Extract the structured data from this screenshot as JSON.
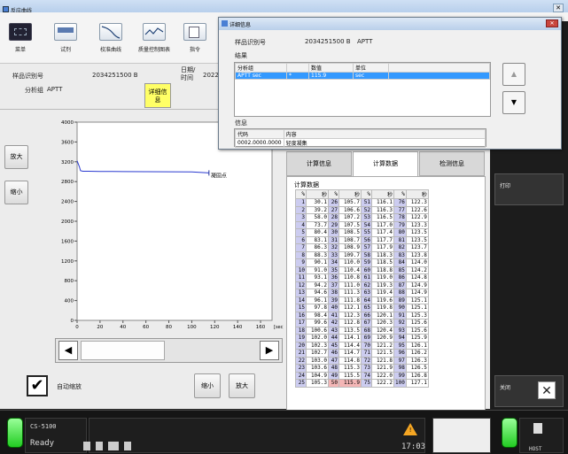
{
  "window": {
    "title": "反应曲线",
    "close": "✕"
  },
  "toolbar": [
    {
      "label": "菜单",
      "icon": "keypad-icon"
    },
    {
      "label": "试剂",
      "icon": "reagent-icon"
    },
    {
      "label": "校准曲线",
      "icon": "calibration-curve-icon"
    },
    {
      "label": "质量控制图表",
      "icon": "qc-chart-icon"
    },
    {
      "label": "指令",
      "icon": "command-icon"
    }
  ],
  "sample": {
    "id_label": "样品识别号",
    "id_value": "2034251500 B",
    "group_label": "分析组",
    "group_value": "APTT",
    "date_label": "日期/\n时间",
    "date_value": "2022-",
    "detail_button": "详细信\n息"
  },
  "left_buttons": {
    "zoom_in": "放大",
    "zoom_out": "缩小"
  },
  "chart_data": {
    "type": "line",
    "x": [
      0,
      2,
      3,
      5,
      10,
      20,
      40,
      60,
      80,
      100,
      115
    ],
    "y": [
      3220,
      3100,
      3020,
      3010,
      3008,
      3005,
      3003,
      3000,
      2998,
      2995,
      2975
    ],
    "xticks": [
      "0",
      "20",
      "40",
      "60",
      "80",
      "100",
      "120",
      "140",
      "160"
    ],
    "yticks": [
      "0",
      "200",
      "400",
      "600",
      "800",
      "1000",
      "1200",
      "1400",
      "1600",
      "1800",
      "2000",
      "2200",
      "2400",
      "2600",
      "2800",
      "3000",
      "3200",
      "3400",
      "3600",
      "3800",
      "4000"
    ],
    "yticks_shown": [
      "0",
      "400",
      "800",
      "1200",
      "1600",
      "2000",
      "2400",
      "2800",
      "3200",
      "3600",
      "4000"
    ],
    "xlim": [
      0,
      170
    ],
    "ylim": [
      0,
      4000
    ],
    "xunit": "[sec]",
    "annotation": "凝固点",
    "annotation_x": 115,
    "annotation_y": 2975,
    "line_color": "#2a3ad0"
  },
  "auto_zoom": {
    "label": "自动缩放",
    "checked": "✔"
  },
  "bottom_buttons": {
    "zoom_out": "缩小",
    "zoom_in": "放大"
  },
  "tabs": [
    "计算信息",
    "计算数据",
    "检测信息"
  ],
  "calc_data": {
    "caption": "计算数据",
    "header": [
      "%",
      "秒",
      "%",
      "秒",
      "%",
      "秒",
      "%",
      "秒"
    ],
    "rows": [
      [
        "1",
        "30.1",
        "26",
        "105.7",
        "51",
        "116.1",
        "76",
        "122.3"
      ],
      [
        "2",
        "39.2",
        "27",
        "106.6",
        "52",
        "116.3",
        "77",
        "122.6"
      ],
      [
        "3",
        "58.0",
        "28",
        "107.2",
        "53",
        "116.5",
        "78",
        "122.9"
      ],
      [
        "4",
        "73.7",
        "29",
        "107.5",
        "54",
        "117.0",
        "79",
        "123.3"
      ],
      [
        "5",
        "80.4",
        "30",
        "108.5",
        "55",
        "117.4",
        "80",
        "123.5"
      ],
      [
        "6",
        "83.1",
        "31",
        "108.7",
        "56",
        "117.7",
        "81",
        "123.5"
      ],
      [
        "7",
        "86.3",
        "32",
        "108.9",
        "57",
        "117.9",
        "82",
        "123.7"
      ],
      [
        "8",
        "88.3",
        "33",
        "109.7",
        "58",
        "118.3",
        "83",
        "123.8"
      ],
      [
        "9",
        "90.1",
        "34",
        "110.0",
        "59",
        "118.5",
        "84",
        "124.0"
      ],
      [
        "10",
        "91.0",
        "35",
        "110.4",
        "60",
        "118.8",
        "85",
        "124.2"
      ],
      [
        "11",
        "93.1",
        "36",
        "110.8",
        "61",
        "119.0",
        "86",
        "124.8"
      ],
      [
        "12",
        "94.2",
        "37",
        "111.0",
        "62",
        "119.3",
        "87",
        "124.9"
      ],
      [
        "13",
        "94.6",
        "38",
        "111.3",
        "63",
        "119.4",
        "88",
        "124.9"
      ],
      [
        "14",
        "96.1",
        "39",
        "111.8",
        "64",
        "119.6",
        "89",
        "125.1"
      ],
      [
        "15",
        "97.8",
        "40",
        "112.1",
        "65",
        "119.8",
        "90",
        "125.1"
      ],
      [
        "16",
        "98.4",
        "41",
        "112.3",
        "66",
        "120.1",
        "91",
        "125.3"
      ],
      [
        "17",
        "99.6",
        "42",
        "112.8",
        "67",
        "120.3",
        "92",
        "125.6"
      ],
      [
        "18",
        "100.6",
        "43",
        "113.5",
        "68",
        "120.4",
        "93",
        "125.6"
      ],
      [
        "19",
        "102.0",
        "44",
        "114.1",
        "69",
        "120.9",
        "94",
        "125.9"
      ],
      [
        "20",
        "102.3",
        "45",
        "114.4",
        "70",
        "121.2",
        "95",
        "126.1"
      ],
      [
        "21",
        "102.7",
        "46",
        "114.7",
        "71",
        "121.5",
        "96",
        "126.2"
      ],
      [
        "22",
        "103.0",
        "47",
        "114.8",
        "72",
        "121.8",
        "97",
        "126.3"
      ],
      [
        "23",
        "103.6",
        "48",
        "115.3",
        "73",
        "121.9",
        "98",
        "126.5"
      ],
      [
        "24",
        "104.9",
        "49",
        "115.5",
        "74",
        "122.0",
        "99",
        "126.8"
      ],
      [
        "25",
        "105.3",
        "50",
        "115.9",
        "75",
        "122.2",
        "100",
        "127.1"
      ]
    ]
  },
  "right_panel": {
    "print": "打印",
    "close": "关闭",
    "close_icon": "✕"
  },
  "dialog": {
    "title": "详细信息",
    "close": "✕",
    "id_label": "样品识别号",
    "id_value": "2034251500 B",
    "group_value": "APTT",
    "results_label": "结果",
    "results_header": [
      "分析组",
      "",
      "数值",
      "单位"
    ],
    "results_row": [
      "APTT sec",
      "*",
      "115.9",
      "sec"
    ],
    "info_label": "信息",
    "info_header": [
      "代码",
      "内容"
    ],
    "info_row": [
      "0002.0000.0000",
      "轻度凝集"
    ],
    "up": "▲",
    "down": "▼"
  },
  "status": {
    "model": "CS-5100",
    "state": "Ready",
    "time": "17:03",
    "host": "HOST",
    "warning": "!"
  }
}
